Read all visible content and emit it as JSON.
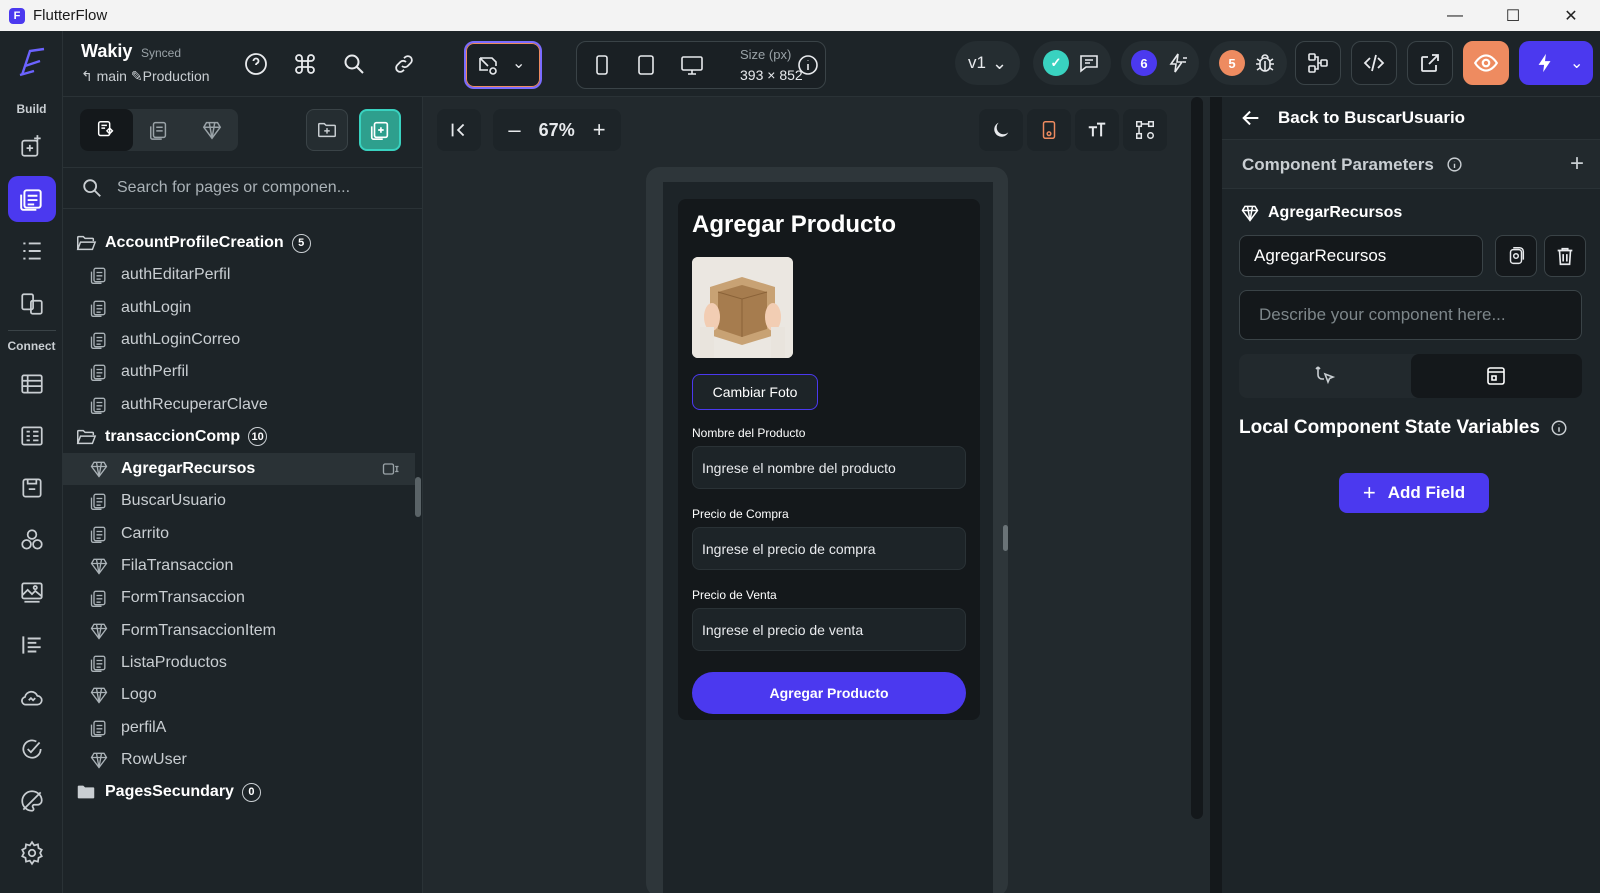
{
  "window": {
    "title": "FlutterFlow",
    "logo_glyph": "F"
  },
  "rail": {
    "build_label": "Build",
    "connect_label": "Connect"
  },
  "toolbar": {
    "project_name": "Wakiy",
    "sync_status": "Synced",
    "branch": "main",
    "environment": "Production",
    "size_label": "Size (px)",
    "size_value": "393 × 852",
    "version": "v1",
    "issues_count": "6",
    "warnings_count": "5"
  },
  "left_panel": {
    "search_placeholder": "Search for pages or componen...",
    "tree": [
      {
        "type": "folder",
        "label": "AccountProfileCreation",
        "count": "5"
      },
      {
        "type": "page",
        "label": "authEditarPerfil"
      },
      {
        "type": "page",
        "label": "authLogin"
      },
      {
        "type": "page",
        "label": "authLoginCorreo"
      },
      {
        "type": "page",
        "label": "authPerfil"
      },
      {
        "type": "page",
        "label": "authRecuperarClave"
      },
      {
        "type": "folder",
        "label": "transaccionComp",
        "count": "10"
      },
      {
        "type": "component",
        "label": "AgregarRecursos",
        "selected": true
      },
      {
        "type": "page",
        "label": "BuscarUsuario"
      },
      {
        "type": "page",
        "label": "Carrito"
      },
      {
        "type": "component",
        "label": "FilaTransaccion"
      },
      {
        "type": "page",
        "label": "FormTransaccion"
      },
      {
        "type": "component",
        "label": "FormTransaccionItem"
      },
      {
        "type": "page",
        "label": "ListaProductos"
      },
      {
        "type": "component",
        "label": "Logo"
      },
      {
        "type": "page",
        "label": "perfilA"
      },
      {
        "type": "component",
        "label": "RowUser"
      },
      {
        "type": "folder-closed",
        "label": "PagesSecundary",
        "count": "0"
      }
    ]
  },
  "canvas": {
    "zoom": "67%",
    "component": {
      "title": "Agregar Producto",
      "change_photo": "Cambiar Foto",
      "name_label": "Nombre del Producto",
      "name_hint": "Ingrese el nombre del producto",
      "buy_label": "Precio de Compra",
      "buy_hint": "Ingrese el precio de compra",
      "sell_label": "Precio de Venta",
      "sell_hint": "Ingrese el precio de venta",
      "submit": "Agregar Producto"
    }
  },
  "right_panel": {
    "back_label": "Back to BuscarUsuario",
    "params_title": "Component Parameters",
    "component_label": "AgregarRecursos",
    "component_name": "AgregarRecursos",
    "description_placeholder": "Describe your component here...",
    "state_title": "Local Component State Variables",
    "add_field": "Add Field"
  },
  "colors": {
    "primary": "#4b39ef",
    "accent": "#39d2c0",
    "warning": "#ee8b60",
    "success": "#39d2c0"
  }
}
